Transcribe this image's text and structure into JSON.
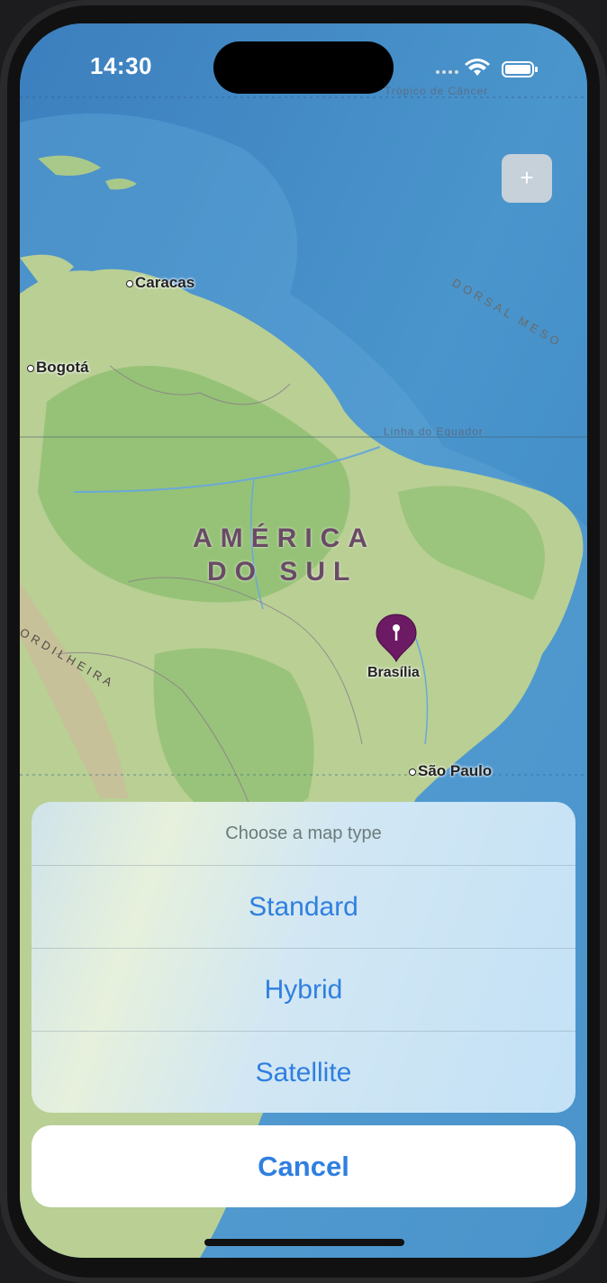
{
  "status_bar": {
    "time": "14:30"
  },
  "map": {
    "zoom_in_label": "+",
    "lines": {
      "tropic": "Trópico de Câncer",
      "equator": "Linha do Equador"
    },
    "ridge_label": "DORSAL MESO",
    "cordillera_label": "ORDILHEIRA",
    "continent_line1": "AMÉRICA",
    "continent_line2": "DO SUL",
    "cities": {
      "caracas": "Caracas",
      "bogota": "Bogotá",
      "sao_paulo": "São Paulo"
    },
    "pin_label": "Brasília"
  },
  "action_sheet": {
    "title": "Choose a map type",
    "options": [
      "Standard",
      "Hybrid",
      "Satellite"
    ],
    "cancel_label": "Cancel"
  },
  "colors": {
    "accent": "#2f7fe0",
    "ocean": "#3f8ac2",
    "land": "#b9cf94",
    "forest": "#8fbf72",
    "pin": "#6b1a63"
  }
}
